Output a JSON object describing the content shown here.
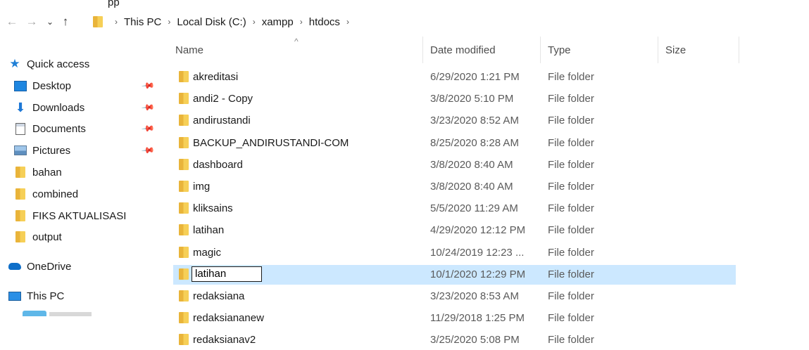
{
  "title_partial": "pp",
  "nav": {
    "back_icon": "arrow-left-icon",
    "forward_icon": "arrow-right-icon",
    "recent_icon": "chevron-down-icon",
    "up_icon": "arrow-up-icon"
  },
  "breadcrumb": [
    "This PC",
    "Local Disk (C:)",
    "xampp",
    "htdocs"
  ],
  "columns": {
    "name": "Name",
    "date": "Date modified",
    "type": "Type",
    "size": "Size"
  },
  "sidebar": {
    "quick_access": "Quick access",
    "items": [
      {
        "label": "Desktop",
        "icon": "desktop-icon",
        "pinned": true
      },
      {
        "label": "Downloads",
        "icon": "download-icon",
        "pinned": true
      },
      {
        "label": "Documents",
        "icon": "document-icon",
        "pinned": true
      },
      {
        "label": "Pictures",
        "icon": "pictures-icon",
        "pinned": true
      },
      {
        "label": "bahan",
        "icon": "folder-icon",
        "pinned": false
      },
      {
        "label": "combined",
        "icon": "folder-icon",
        "pinned": false
      },
      {
        "label": "FIKS AKTUALISASI",
        "icon": "folder-icon",
        "pinned": false
      },
      {
        "label": "output",
        "icon": "folder-icon",
        "pinned": false
      }
    ],
    "onedrive": "OneDrive",
    "thispc": "This PC"
  },
  "files": [
    {
      "name": "akreditasi",
      "date": "6/29/2020 1:21 PM",
      "type": "File folder"
    },
    {
      "name": "andi2 - Copy",
      "date": "3/8/2020 5:10 PM",
      "type": "File folder"
    },
    {
      "name": "andirustandi",
      "date": "3/23/2020 8:52 AM",
      "type": "File folder"
    },
    {
      "name": "BACKUP_ANDIRUSTANDI-COM",
      "date": "8/25/2020 8:28 AM",
      "type": "File folder"
    },
    {
      "name": "dashboard",
      "date": "3/8/2020 8:40 AM",
      "type": "File folder"
    },
    {
      "name": "img",
      "date": "3/8/2020 8:40 AM",
      "type": "File folder"
    },
    {
      "name": "kliksains",
      "date": "5/5/2020 11:29 AM",
      "type": "File folder"
    },
    {
      "name": "latihan",
      "date": "4/29/2020 12:12 PM",
      "type": "File folder"
    },
    {
      "name": "magic",
      "date": "10/24/2019 12:23 ...",
      "type": "File folder"
    },
    {
      "name": "latihan",
      "date": "10/1/2020 12:29 PM",
      "type": "File folder",
      "selected": true,
      "renaming": true
    },
    {
      "name": "redaksiana",
      "date": "3/23/2020 8:53 AM",
      "type": "File folder"
    },
    {
      "name": "redaksiananew",
      "date": "11/29/2018 1:25 PM",
      "type": "File folder"
    },
    {
      "name": "redaksianav2",
      "date": "3/25/2020 5:08 PM",
      "type": "File folder"
    }
  ],
  "colors": {
    "selection": "#cce8ff",
    "folder": "#f6cf57",
    "accent": "#0078d7"
  }
}
